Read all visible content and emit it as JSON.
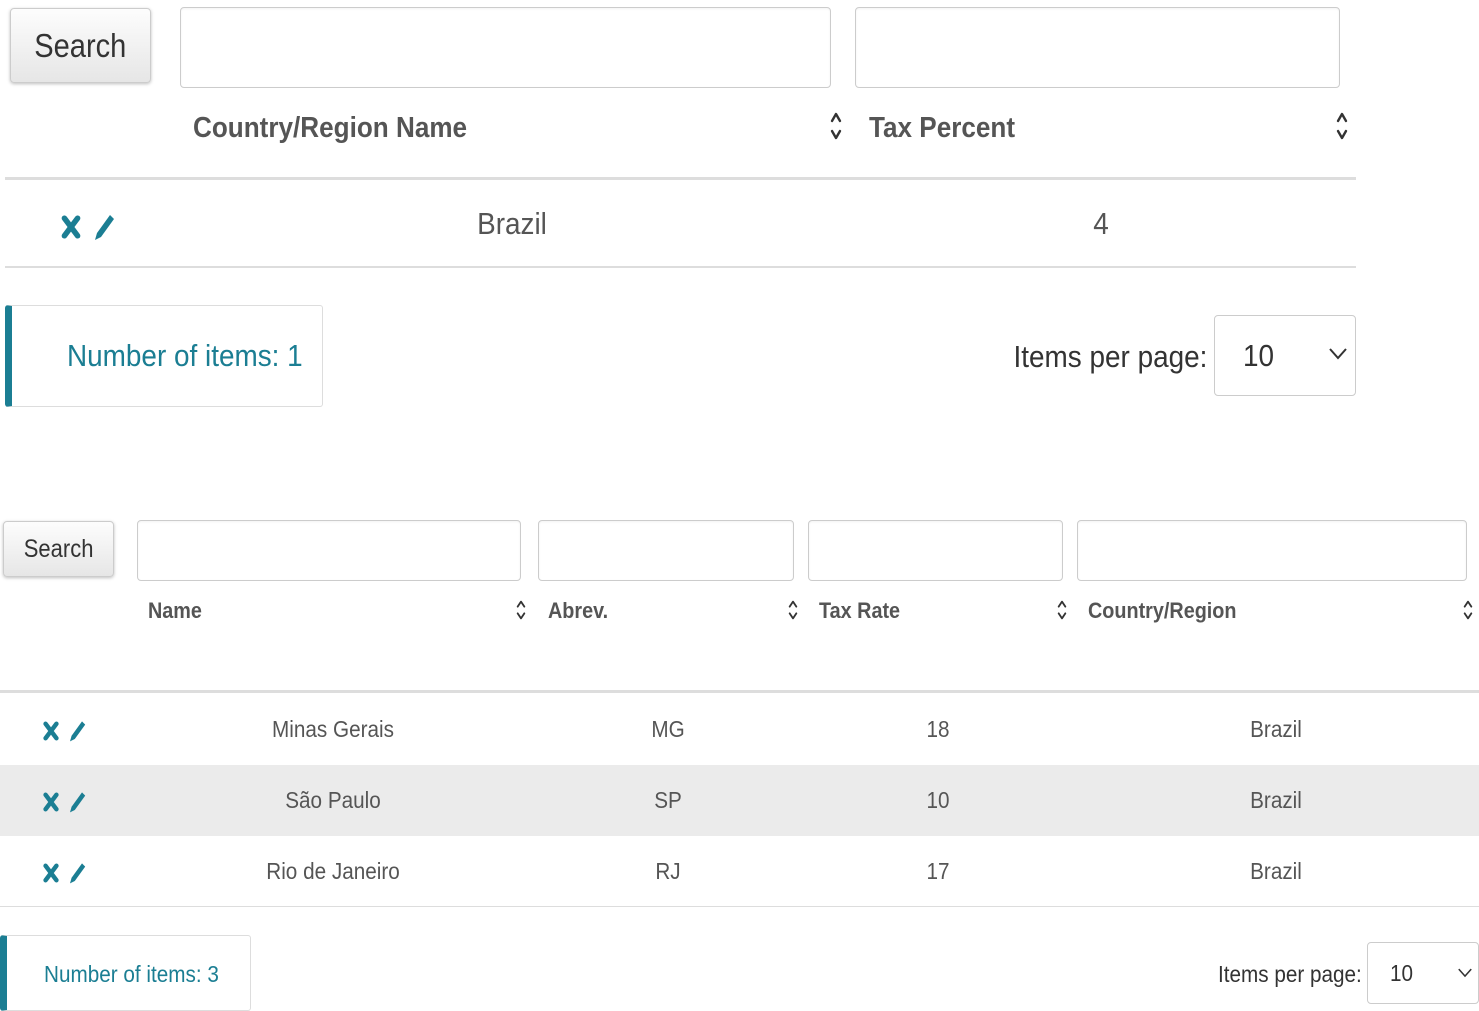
{
  "countries": {
    "search_label": "Search",
    "search_inputs": [
      "",
      ""
    ],
    "columns": [
      "Country/Region Name",
      "Tax Percent"
    ],
    "rows": [
      {
        "name": "Brazil",
        "tax": "4"
      }
    ],
    "count_text": "Number of items: 1",
    "items_per_page_label": "Items per page:",
    "items_per_page_value": "10"
  },
  "states": {
    "search_label": "Search",
    "search_inputs": [
      "",
      "",
      "",
      ""
    ],
    "columns": [
      "Name",
      "Abrev.",
      "Tax Rate",
      "Country/Region"
    ],
    "rows": [
      {
        "name": "Minas Gerais",
        "abrev": "MG",
        "tax_rate": "18",
        "country": "Brazil"
      },
      {
        "name": "São Paulo",
        "abrev": "SP",
        "tax_rate": "10",
        "country": "Brazil"
      },
      {
        "name": "Rio de Janeiro",
        "abrev": "RJ",
        "tax_rate": "17",
        "country": "Brazil"
      }
    ],
    "count_text": "Number of items: 3",
    "items_per_page_label": "Items per page:",
    "items_per_page_value": "10"
  },
  "icons": {
    "delete": "delete-icon",
    "edit": "edit-icon",
    "sort": "sort-icon",
    "dropdown": "chevron-down-icon"
  },
  "colors": {
    "accent": "#1b7e93",
    "row_highlight": "#ebebeb"
  }
}
